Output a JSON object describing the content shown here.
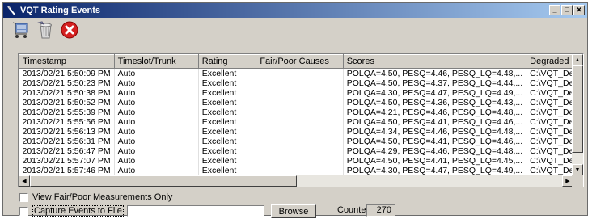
{
  "window": {
    "title": "VQT Rating Events"
  },
  "title_buttons": {
    "minimize": "_",
    "maximize": "□",
    "close": "✕"
  },
  "toolbar": {
    "icons": [
      "cart-icon",
      "trash-icon",
      "close-circle-icon"
    ],
    "close_color": "#d42020"
  },
  "table": {
    "columns": [
      "Timestamp",
      "Timeslot/Trunk",
      "Rating",
      "Fair/Poor Causes",
      "Scores",
      "Degraded Fi"
    ],
    "rows": [
      [
        "2013/02/21 5:50:09 PM",
        "Auto",
        "Excellent",
        "",
        "POLQA=4.50, PESQ=4.46, PESQ_LQ=4.48,...",
        "C:\\VQT_De"
      ],
      [
        "2013/02/21 5:50:23 PM",
        "Auto",
        "Excellent",
        "",
        "POLQA=4.50, PESQ=4.37, PESQ_LQ=4.44,...",
        "C:\\VQT_De"
      ],
      [
        "2013/02/21 5:50:38 PM",
        "Auto",
        "Excellent",
        "",
        "POLQA=4.30, PESQ=4.47, PESQ_LQ=4.49,...",
        "C:\\VQT_De"
      ],
      [
        "2013/02/21 5:50:52 PM",
        "Auto",
        "Excellent",
        "",
        "POLQA=4.50, PESQ=4.36, PESQ_LQ=4.43,...",
        "C:\\VQT_De"
      ],
      [
        "2013/02/21 5:55:39 PM",
        "Auto",
        "Excellent",
        "",
        "POLQA=4.21, PESQ=4.46, PESQ_LQ=4.48,...",
        "C:\\VQT_De"
      ],
      [
        "2013/02/21 5:55:56 PM",
        "Auto",
        "Excellent",
        "",
        "POLQA=4.50, PESQ=4.41, PESQ_LQ=4.46,...",
        "C:\\VQT_De"
      ],
      [
        "2013/02/21 5:56:13 PM",
        "Auto",
        "Excellent",
        "",
        "POLQA=4.34, PESQ=4.46, PESQ_LQ=4.48,...",
        "C:\\VQT_De"
      ],
      [
        "2013/02/21 5:56:31 PM",
        "Auto",
        "Excellent",
        "",
        "POLQA=4.50, PESQ=4.41, PESQ_LQ=4.46,...",
        "C:\\VQT_De"
      ],
      [
        "2013/02/21 5:56:47 PM",
        "Auto",
        "Excellent",
        "",
        "POLQA=4.29, PESQ=4.46, PESQ_LQ=4.48,...",
        "C:\\VQT_De"
      ],
      [
        "2013/02/21 5:57:07 PM",
        "Auto",
        "Excellent",
        "",
        "POLQA=4.50, PESQ=4.41, PESQ_LQ=4.45,...",
        "C:\\VQT_De"
      ],
      [
        "2013/02/21 5:57:46 PM",
        "Auto",
        "Excellent",
        "",
        "POLQA=4.30, PESQ=4.47, PESQ_LQ=4.49,...",
        "C:\\VQT_De"
      ]
    ]
  },
  "options": {
    "fair_poor_only": "View Fair/Poor Measurements Only",
    "capture_to_file": "Capture Events to File",
    "file_path_value": "",
    "browse_label": "Browse",
    "counter_label": "Counter",
    "counter_value": "270"
  }
}
